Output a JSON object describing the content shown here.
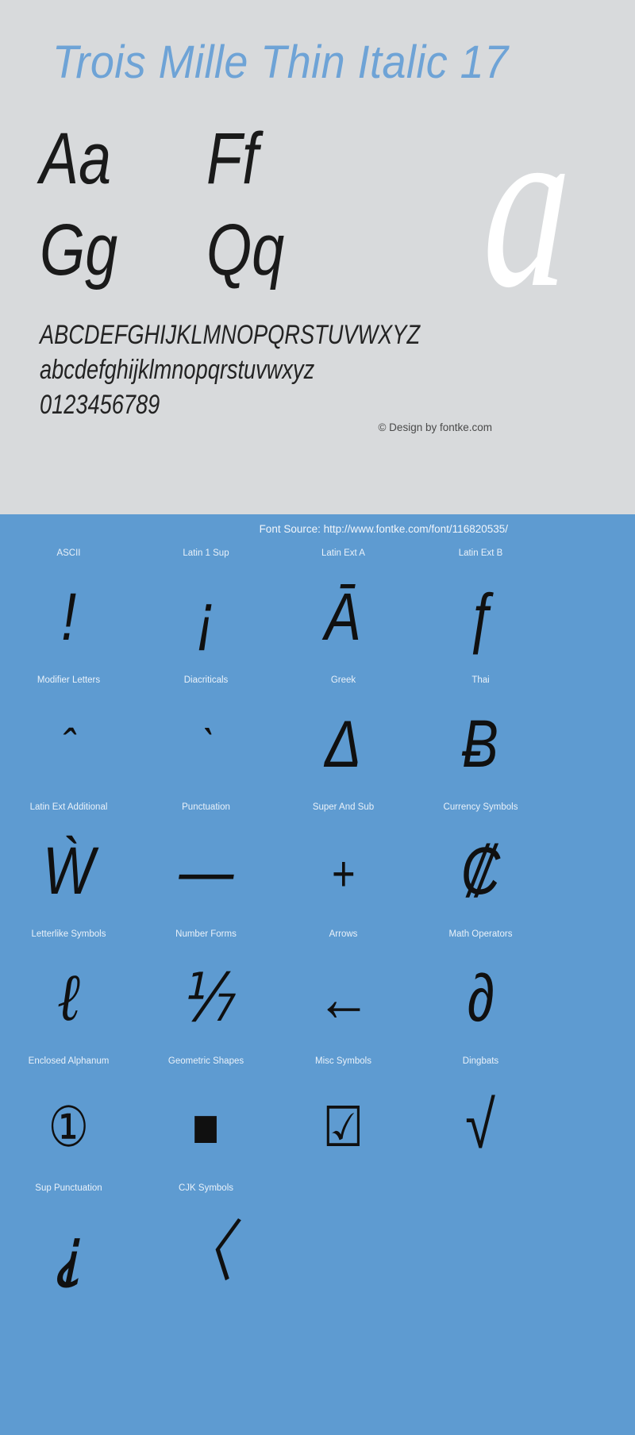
{
  "page": {
    "background_color": "#d8dadc",
    "accent_color": "#5e9bd1",
    "title_color": "#6ea3d6"
  },
  "header": {
    "title": "Trois Mille Thin Italic 17"
  },
  "specimen": {
    "big_glyph": "a",
    "pairs": [
      [
        "Aa",
        "Ff"
      ],
      [
        "Gg",
        "Qq"
      ]
    ],
    "alphabet_upper": "ABCDEFGHIJKLMNOPQRSTUVWXYZ",
    "alphabet_lower": "abcdefghijklmnopqrstuvwxyz",
    "digits": "0123456789"
  },
  "credit": {
    "copyright": "© Design by fontke.com",
    "source": "Font Source: http://www.fontke.com/font/116820535/"
  },
  "unicode_blocks": {
    "rows": [
      {
        "labels": [
          "ASCII",
          "Latin 1 Sup",
          "Latin Ext A",
          "Latin Ext B"
        ],
        "glyphs": [
          "!",
          "¡",
          "Ā",
          "ƒ"
        ],
        "styles": [
          "",
          "",
          "",
          ""
        ]
      },
      {
        "labels": [
          "Modifier Letters",
          "Diacriticals",
          "Greek",
          "Thai"
        ],
        "glyphs": [
          "ˆ",
          "ˋ",
          "Δ",
          "Ƀ"
        ],
        "styles": [
          "small",
          "small",
          "",
          ""
        ]
      },
      {
        "labels": [
          "Latin Ext Additional",
          "Punctuation",
          "Super And Sub",
          "Currency Symbols"
        ],
        "glyphs": [
          "Ẁ",
          "—",
          "+",
          "₡"
        ],
        "styles": [
          "",
          "",
          "small",
          ""
        ]
      },
      {
        "labels": [
          "Letterlike Symbols",
          "Number Forms",
          "Arrows",
          "Math Operators"
        ],
        "glyphs": [
          "ℓ",
          "⅐",
          "←",
          "∂"
        ],
        "styles": [
          "serif",
          "",
          "",
          ""
        ]
      },
      {
        "labels": [
          "Enclosed Alphanum",
          "Geometric Shapes",
          "Misc Symbols",
          "Dingbats"
        ],
        "glyphs": [
          "①",
          "■",
          "☑",
          "√"
        ],
        "styles": [
          "box",
          "box",
          "box",
          ""
        ]
      },
      {
        "labels": [
          "Sup Punctuation",
          "CJK Symbols",
          "",
          ""
        ],
        "glyphs": [
          "⸘",
          "〈",
          "",
          ""
        ],
        "styles": [
          "",
          "",
          "",
          ""
        ]
      }
    ]
  }
}
